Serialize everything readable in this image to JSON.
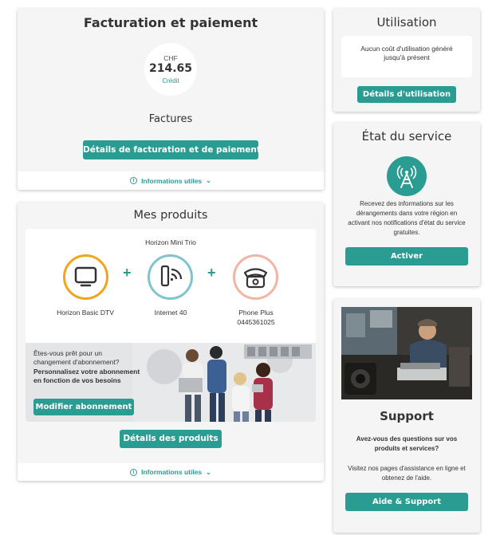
{
  "billing": {
    "title": "Facturation et paiement",
    "currency": "CHF",
    "amount": "214.65",
    "status": "Crédit",
    "invoices_heading": "Factures",
    "details_button": "Détails de facturation et de paiement",
    "info_link": "Informations utiles"
  },
  "products": {
    "title": "Mes produits",
    "bundle_name": "Horizon Mini Trio",
    "items": [
      {
        "label": "Horizon Basic DTV",
        "sub": "",
        "icon": "tv-icon",
        "ring": "#f2a41c"
      },
      {
        "label": "Internet 40",
        "sub": "",
        "icon": "internet-modem-icon",
        "ring": "#7fc4cf"
      },
      {
        "label": "Phone Plus",
        "sub": "0445361025",
        "icon": "phone-icon",
        "ring": "#f3b4a4"
      }
    ],
    "promo": {
      "question": "Êtes-vous prêt pour un changement d'abonnement?",
      "highlight": "Personnalisez votre abonnement en fonction de vos besoins",
      "button": "Modifier abonnement"
    },
    "details_button": "Détails des produits",
    "info_link": "Informations utiles"
  },
  "usage": {
    "title": "Utilisation",
    "message": "Aucun coût d'utilisation généré jusqu'à présent",
    "button": "Détails d'utilisation"
  },
  "service": {
    "title": "État du service",
    "description": "Recevez des informations sur les dérangements dans votre région en activant nos notifications d'état du service gratuites.",
    "button": "Activer"
  },
  "support": {
    "title": "Support",
    "question": "Avez-vous des questions sur vos produits et services?",
    "text": "Visitez nos pages d'assistance en ligne et obtenez de l'aide.",
    "button": "Aide & Support"
  },
  "colors": {
    "accent": "#2a9c92",
    "credit": "#2a9c92"
  }
}
